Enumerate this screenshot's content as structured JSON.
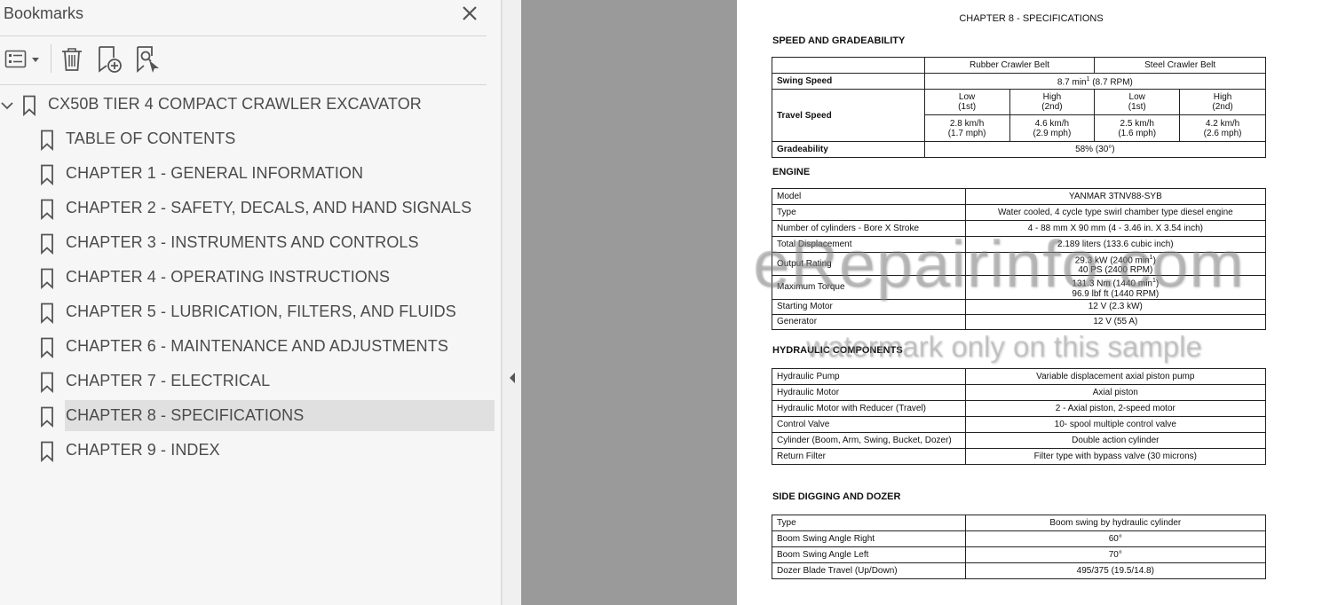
{
  "bookmarks_panel": {
    "title": "Bookmarks",
    "icons": {
      "close": "close-icon",
      "options": "list-options-icon",
      "delete": "trash-icon",
      "new_bookmark": "add-bookmark-icon",
      "find_bookmark": "find-bookmark-icon"
    },
    "root": {
      "label": "CX50B TIER 4 COMPACT CRAWLER EXCAVATOR",
      "expanded": true
    },
    "items": [
      {
        "label": "TABLE OF CONTENTS"
      },
      {
        "label": "CHAPTER 1 - GENERAL INFORMATION"
      },
      {
        "label": "CHAPTER 2 - SAFETY, DECALS, AND HAND SIGNALS"
      },
      {
        "label": "CHAPTER 3 - INSTRUMENTS AND CONTROLS"
      },
      {
        "label": "CHAPTER 4 - OPERATING INSTRUCTIONS"
      },
      {
        "label": "CHAPTER 5 - LUBRICATION, FILTERS, AND FLUIDS"
      },
      {
        "label": "CHAPTER 6 - MAINTENANCE AND ADJUSTMENTS"
      },
      {
        "label": "CHAPTER 7 - ELECTRICAL"
      },
      {
        "label": "CHAPTER 8 - SPECIFICATIONS",
        "selected": true
      },
      {
        "label": "CHAPTER 9 - INDEX"
      }
    ]
  },
  "colors": {
    "panel_bg": "#f6f6f6",
    "selected_bg": "#e0e0e0",
    "gutter": "#9a9a9a",
    "page": "#ffffff"
  },
  "document": {
    "chapter_title": "CHAPTER 8 - SPECIFICATIONS",
    "speed": {
      "title": "SPEED AND GRADEABILITY",
      "col_rubber": "Rubber Crawler Belt",
      "col_steel": "Steel Crawler Belt",
      "swing_label": "Swing Speed",
      "swing_value_main": "8.7 min",
      "swing_value_sup": "1",
      "swing_value_rest": " (8.7 RPM)",
      "travel_label": "Travel Speed",
      "low": "Low",
      "low_gear": "(1st)",
      "high": "High",
      "high_gear": "(2nd)",
      "travel_values": [
        {
          "kmh": "2.8 km/h",
          "mph": "(1.7 mph)"
        },
        {
          "kmh": "4.6 km/h",
          "mph": "(2.9 mph)"
        },
        {
          "kmh": "2.5 km/h",
          "mph": "(1.6 mph)"
        },
        {
          "kmh": "4.2 km/h",
          "mph": "(2.6 mph)"
        }
      ],
      "grade_label": "Gradeability",
      "grade_value": "58% (30°)"
    },
    "engine": {
      "title": "ENGINE",
      "rows": [
        {
          "label": "Model",
          "value": "YANMAR 3TNV88-SYB"
        },
        {
          "label": "Type",
          "value": "Water cooled, 4 cycle type swirl chamber type diesel engine"
        },
        {
          "label": "Number of cylinders - Bore X Stroke",
          "value": "4 - 88 mm X 90 mm (4 - 3.46 in. X 3.54 inch)"
        },
        {
          "label": "Total Displacement",
          "value": "2.189 liters (133.6 cubic inch)"
        }
      ],
      "output_label": "Output Rating",
      "output_line1_main": "29.3 kW (2400 min",
      "output_line1_sup": "1",
      "output_line1_end": ")",
      "output_line2": "40 PS (2400 RPM)",
      "torque_label": "Maximum Torque",
      "torque_line1_main": "131.3 Nm (1440 min",
      "torque_line1_sup": "1",
      "torque_line1_end": ")",
      "torque_line2": "96.9 lbf ft (1440 RPM)",
      "rows2": [
        {
          "label": "Starting Motor",
          "value": "12 V (2.3 kW)"
        },
        {
          "label": "Generator",
          "value": "12 V (55 A)"
        }
      ]
    },
    "hydraulic": {
      "title": "HYDRAULIC COMPONENTS",
      "rows": [
        {
          "label": "Hydraulic Pump",
          "value": "Variable displacement axial piston pump"
        },
        {
          "label": "Hydraulic Motor",
          "value": "Axial piston"
        },
        {
          "label": "Hydraulic Motor with Reducer (Travel)",
          "value": "2 - Axial piston, 2-speed motor"
        },
        {
          "label": "Control Valve",
          "value": "10- spool multiple control valve"
        },
        {
          "label": "Cylinder (Boom, Arm, Swing, Bucket, Dozer)",
          "value": "Double action cylinder"
        },
        {
          "label": "Return Filter",
          "value": "Filter type with bypass valve (30 microns)"
        }
      ]
    },
    "side_digging": {
      "title": "SIDE DIGGING AND DOZER",
      "rows": [
        {
          "label": "Type",
          "value": "Boom swing by hydraulic cylinder"
        },
        {
          "label": "Boom Swing Angle Right",
          "value": "60°"
        },
        {
          "label": "Boom Swing Angle Left",
          "value": "70°"
        },
        {
          "label": "Dozer Blade Travel (Up/Down)",
          "value": "495/375 (19.5/14.8)"
        }
      ]
    }
  },
  "watermark": {
    "main": "eRepairinfo.com",
    "sub": "watermark only on this sample"
  }
}
